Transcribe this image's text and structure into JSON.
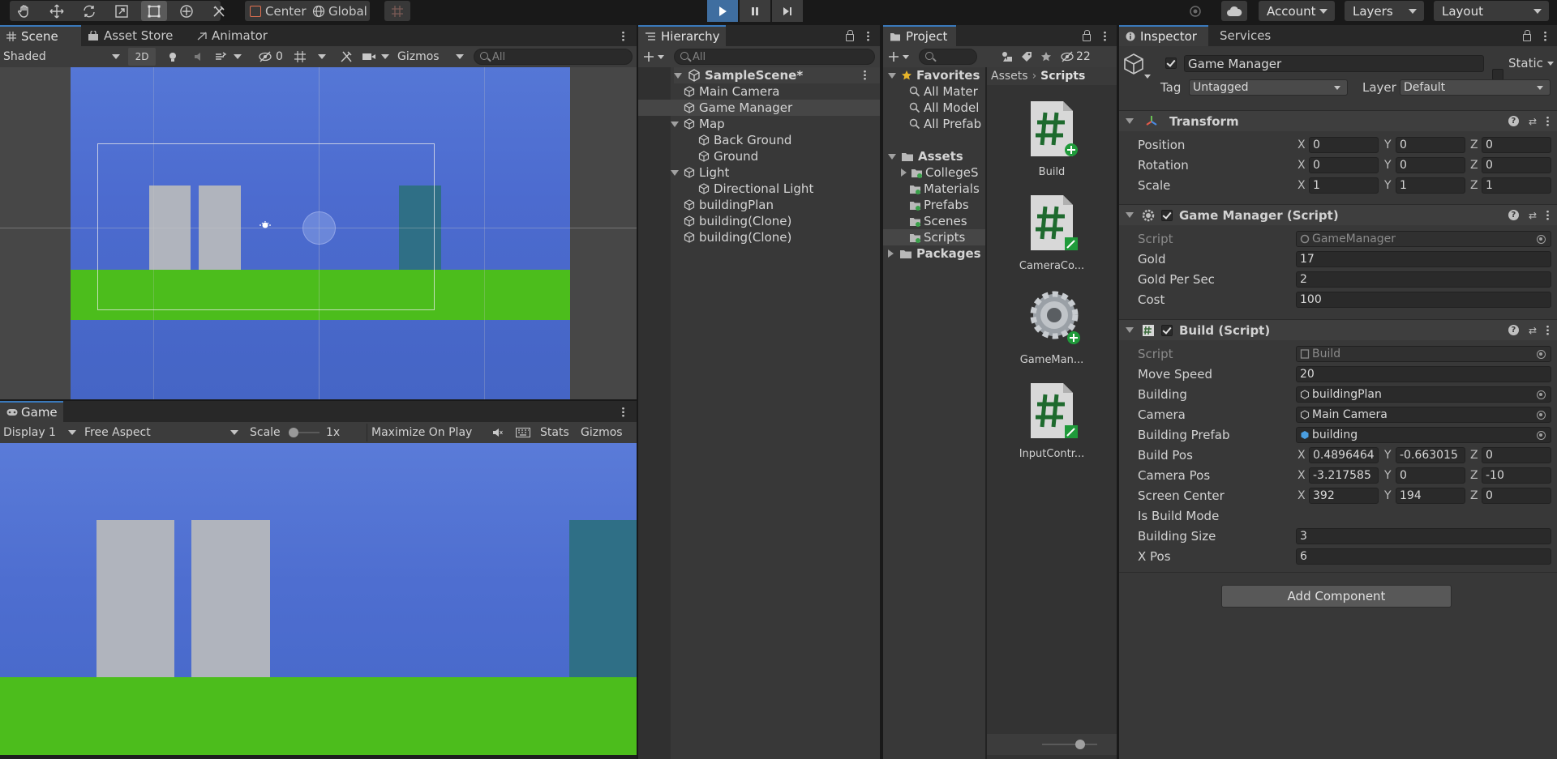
{
  "toolbar": {
    "pivot_label": "Center",
    "space_label": "Global",
    "account_label": "Account",
    "layers_label": "Layers",
    "layout_label": "Layout"
  },
  "scene": {
    "tabs": [
      "Scene",
      "Asset Store",
      "Animator"
    ],
    "shading_mode": "Shaded",
    "two_d_label": "2D",
    "hidden_count": "0",
    "gizmos_label": "Gizmos",
    "search_placeholder": "All",
    "colors": {
      "sky": "#4f6fd0",
      "ground": "#4cbd1c",
      "building": "#b0b4bd",
      "teal": "#2f6f86"
    }
  },
  "game": {
    "tab_label": "Game",
    "display": "Display 1",
    "aspect": "Free Aspect",
    "scale_label": "Scale",
    "scale_value": "1x",
    "maximize_label": "Maximize On Play",
    "stats_label": "Stats",
    "gizmos_label": "Gizmos"
  },
  "hierarchy": {
    "tab_label": "Hierarchy",
    "search_placeholder": "All",
    "scene_name": "SampleScene*",
    "items": [
      {
        "label": "Main Camera",
        "depth": 1,
        "expand": "",
        "selected": false
      },
      {
        "label": "Game Manager",
        "depth": 1,
        "expand": "",
        "selected": true
      },
      {
        "label": "Map",
        "depth": 1,
        "expand": "open",
        "selected": false
      },
      {
        "label": "Back Ground",
        "depth": 2,
        "expand": "",
        "selected": false
      },
      {
        "label": "Ground",
        "depth": 2,
        "expand": "",
        "selected": false
      },
      {
        "label": "Light",
        "depth": 1,
        "expand": "open",
        "selected": false
      },
      {
        "label": "Directional Light",
        "depth": 2,
        "expand": "",
        "selected": false
      },
      {
        "label": "buildingPlan",
        "depth": 1,
        "expand": "",
        "selected": false
      },
      {
        "label": "building(Clone)",
        "depth": 1,
        "expand": "",
        "selected": false
      },
      {
        "label": "building(Clone)",
        "depth": 1,
        "expand": "",
        "selected": false
      }
    ]
  },
  "project": {
    "tab_label": "Project",
    "hidden_count": "22",
    "favorites_label": "Favorites",
    "favorites": [
      "All Mater",
      "All Model",
      "All Prefab"
    ],
    "assets_label": "Assets",
    "asset_folders": [
      "CollegeS",
      "Materials",
      "Prefabs",
      "Scenes",
      "Scripts"
    ],
    "packages_label": "Packages",
    "breadcrumb": [
      "Assets",
      "Scripts"
    ],
    "files": [
      {
        "label": "Build",
        "icon": "csharp-script-icon",
        "badge": "plus"
      },
      {
        "label": "CameraCo...",
        "icon": "csharp-script-icon",
        "badge": "edit"
      },
      {
        "label": "GameMan...",
        "icon": "gear-icon",
        "badge": "plus"
      },
      {
        "label": "InputContr...",
        "icon": "csharp-script-icon",
        "badge": "edit"
      }
    ]
  },
  "inspector": {
    "tab_label": "Inspector",
    "services_label": "Services",
    "object_name": "Game Manager",
    "static_label": "Static",
    "tag_label": "Tag",
    "tag_value": "Untagged",
    "layer_label": "Layer",
    "layer_value": "Default",
    "transform": {
      "title": "Transform",
      "rows": [
        {
          "label": "Position",
          "x": "0",
          "y": "0",
          "z": "0"
        },
        {
          "label": "Rotation",
          "x": "0",
          "y": "0",
          "z": "0"
        },
        {
          "label": "Scale",
          "x": "1",
          "y": "1",
          "z": "1"
        }
      ]
    },
    "game_manager": {
      "title": "Game Manager (Script)",
      "script_label": "Script",
      "script_value": "GameManager",
      "gold_label": "Gold",
      "gold": "17",
      "gold_per_sec_label": "Gold Per Sec",
      "gold_per_sec": "2",
      "cost_label": "Cost",
      "cost": "100"
    },
    "build": {
      "title": "Build (Script)",
      "script_label": "Script",
      "script_value": "Build",
      "move_speed_label": "Move Speed",
      "move_speed": "20",
      "building_label": "Building",
      "building": "buildingPlan",
      "camera_label": "Camera",
      "camera": "Main Camera",
      "building_prefab_label": "Building Prefab",
      "building_prefab": "building",
      "build_pos_label": "Build Pos",
      "build_pos": {
        "x": "0.4896464",
        "y": "-0.663015",
        "z": "0"
      },
      "camera_pos_label": "Camera Pos",
      "camera_pos": {
        "x": "-3.217585",
        "y": "0",
        "z": "-10"
      },
      "screen_center_label": "Screen Center",
      "screen_center": {
        "x": "392",
        "y": "194",
        "z": "0"
      },
      "is_build_mode_label": "Is Build Mode",
      "is_build_mode": true,
      "building_size_label": "Building Size",
      "building_size": "3",
      "x_pos_label": "X Pos",
      "x_pos": "6"
    },
    "axis": {
      "x": "X",
      "y": "Y",
      "z": "Z"
    },
    "add_component_label": "Add Component"
  }
}
